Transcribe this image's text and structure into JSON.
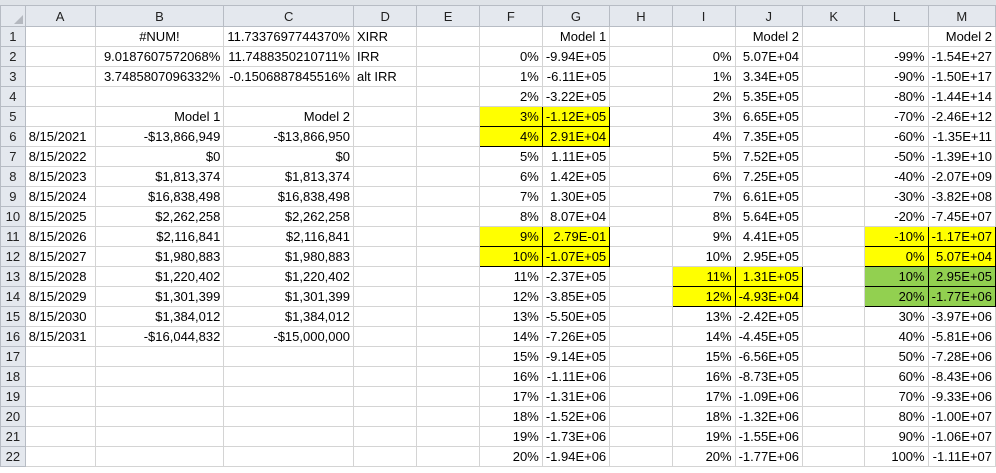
{
  "columns": [
    "A",
    "B",
    "C",
    "D",
    "E",
    "F",
    "G",
    "H",
    "I",
    "J",
    "K",
    "L",
    "M"
  ],
  "rows": [
    {
      "n": "1",
      "a": "",
      "b": "#NUM!",
      "c": "11.7337697744370%",
      "d": "XIRR",
      "f": "",
      "g": "Model 1",
      "i": "",
      "j": "Model 2",
      "l": "",
      "m": "Model 2"
    },
    {
      "n": "2",
      "a": "",
      "b": "9.0187607572068%",
      "c": "11.7488350210711%",
      "d": "IRR",
      "f": "0%",
      "g": "-9.94E+05",
      "i": "0%",
      "j": "5.07E+04",
      "l": "-99%",
      "m": "-1.54E+27"
    },
    {
      "n": "3",
      "a": "",
      "b": "3.7485807096332%",
      "c": "-0.1506887845516%",
      "d": "alt IRR",
      "f": "1%",
      "g": "-6.11E+05",
      "i": "1%",
      "j": "3.34E+05",
      "l": "-90%",
      "m": "-1.50E+17"
    },
    {
      "n": "4",
      "a": "",
      "b": "",
      "c": "",
      "d": "",
      "f": "2%",
      "g": "-3.22E+05",
      "i": "2%",
      "j": "5.35E+05",
      "l": "-80%",
      "m": "-1.44E+14"
    },
    {
      "n": "5",
      "a": "",
      "b": "Model 1",
      "c": "Model 2",
      "d": "",
      "f": "3%",
      "g": "-1.12E+05",
      "i": "3%",
      "j": "6.65E+05",
      "l": "-70%",
      "m": "-2.46E+12"
    },
    {
      "n": "6",
      "a": "8/15/2021",
      "b": "-$13,866,949",
      "c": "-$13,866,950",
      "d": "",
      "f": "4%",
      "g": "2.91E+04",
      "i": "4%",
      "j": "7.35E+05",
      "l": "-60%",
      "m": "-1.35E+11"
    },
    {
      "n": "7",
      "a": "8/15/2022",
      "b": "$0",
      "c": "$0",
      "d": "",
      "f": "5%",
      "g": "1.11E+05",
      "i": "5%",
      "j": "7.52E+05",
      "l": "-50%",
      "m": "-1.39E+10"
    },
    {
      "n": "8",
      "a": "8/15/2023",
      "b": "$1,813,374",
      "c": "$1,813,374",
      "d": "",
      "f": "6%",
      "g": "1.42E+05",
      "i": "6%",
      "j": "7.25E+05",
      "l": "-40%",
      "m": "-2.07E+09"
    },
    {
      "n": "9",
      "a": "8/15/2024",
      "b": "$16,838,498",
      "c": "$16,838,498",
      "d": "",
      "f": "7%",
      "g": "1.30E+05",
      "i": "7%",
      "j": "6.61E+05",
      "l": "-30%",
      "m": "-3.82E+08"
    },
    {
      "n": "10",
      "a": "8/15/2025",
      "b": "$2,262,258",
      "c": "$2,262,258",
      "d": "",
      "f": "8%",
      "g": "8.07E+04",
      "i": "8%",
      "j": "5.64E+05",
      "l": "-20%",
      "m": "-7.45E+07"
    },
    {
      "n": "11",
      "a": "8/15/2026",
      "b": "$2,116,841",
      "c": "$2,116,841",
      "d": "",
      "f": "9%",
      "g": "2.79E-01",
      "i": "9%",
      "j": "4.41E+05",
      "l": "-10%",
      "m": "-1.17E+07"
    },
    {
      "n": "12",
      "a": "8/15/2027",
      "b": "$1,980,883",
      "c": "$1,980,883",
      "d": "",
      "f": "10%",
      "g": "-1.07E+05",
      "i": "10%",
      "j": "2.95E+05",
      "l": "0%",
      "m": "5.07E+04"
    },
    {
      "n": "13",
      "a": "8/15/2028",
      "b": "$1,220,402",
      "c": "$1,220,402",
      "d": "",
      "f": "11%",
      "g": "-2.37E+05",
      "i": "11%",
      "j": "1.31E+05",
      "l": "10%",
      "m": "2.95E+05"
    },
    {
      "n": "14",
      "a": "8/15/2029",
      "b": "$1,301,399",
      "c": "$1,301,399",
      "d": "",
      "f": "12%",
      "g": "-3.85E+05",
      "i": "12%",
      "j": "-4.93E+04",
      "l": "20%",
      "m": "-1.77E+06"
    },
    {
      "n": "15",
      "a": "8/15/2030",
      "b": "$1,384,012",
      "c": "$1,384,012",
      "d": "",
      "f": "13%",
      "g": "-5.50E+05",
      "i": "13%",
      "j": "-2.42E+05",
      "l": "30%",
      "m": "-3.97E+06"
    },
    {
      "n": "16",
      "a": "8/15/2031",
      "b": "-$16,044,832",
      "c": "-$15,000,000",
      "d": "",
      "f": "14%",
      "g": "-7.26E+05",
      "i": "14%",
      "j": "-4.45E+05",
      "l": "40%",
      "m": "-5.81E+06"
    },
    {
      "n": "17",
      "a": "",
      "b": "",
      "c": "",
      "d": "",
      "f": "15%",
      "g": "-9.14E+05",
      "i": "15%",
      "j": "-6.56E+05",
      "l": "50%",
      "m": "-7.28E+06"
    },
    {
      "n": "18",
      "a": "",
      "b": "",
      "c": "",
      "d": "",
      "f": "16%",
      "g": "-1.11E+06",
      "i": "16%",
      "j": "-8.73E+05",
      "l": "60%",
      "m": "-8.43E+06"
    },
    {
      "n": "19",
      "a": "",
      "b": "",
      "c": "",
      "d": "",
      "f": "17%",
      "g": "-1.31E+06",
      "i": "17%",
      "j": "-1.09E+06",
      "l": "70%",
      "m": "-9.33E+06"
    },
    {
      "n": "20",
      "a": "",
      "b": "",
      "c": "",
      "d": "",
      "f": "18%",
      "g": "-1.52E+06",
      "i": "18%",
      "j": "-1.32E+06",
      "l": "80%",
      "m": "-1.00E+07"
    },
    {
      "n": "21",
      "a": "",
      "b": "",
      "c": "",
      "d": "",
      "f": "19%",
      "g": "-1.73E+06",
      "i": "19%",
      "j": "-1.55E+06",
      "l": "90%",
      "m": "-1.06E+07"
    },
    {
      "n": "22",
      "a": "",
      "b": "",
      "c": "",
      "d": "",
      "f": "20%",
      "g": "-1.94E+06",
      "i": "20%",
      "j": "-1.77E+06",
      "l": "100%",
      "m": "-1.11E+07"
    }
  ],
  "highlight_colors": {
    "yellow": "#ffff00",
    "green": "#92d050",
    "header": "#e4e8ee"
  }
}
